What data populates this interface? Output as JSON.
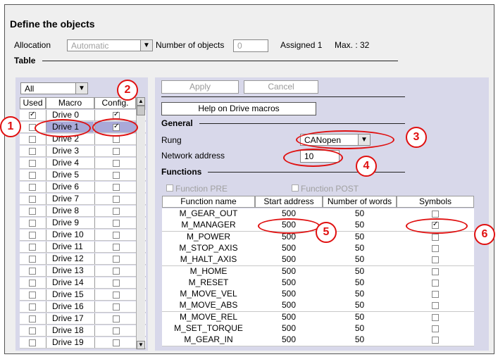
{
  "title": "Define the objects",
  "allocation": {
    "label": "Allocation",
    "value": "Automatic"
  },
  "num_objects": {
    "label": "Number of objects",
    "value": "0"
  },
  "assigned": "Assigned 1",
  "max": "Max. : 32",
  "table_label": "Table",
  "filter": {
    "value": "All"
  },
  "left_headers": {
    "used": "Used",
    "macro": "Macro",
    "config": "Config."
  },
  "macros": [
    {
      "name": "Drive 0",
      "used": true,
      "config": true
    },
    {
      "name": "Drive 1",
      "used": false,
      "config": true
    },
    {
      "name": "Drive 2",
      "used": false,
      "config": false
    },
    {
      "name": "Drive 3",
      "used": false,
      "config": false
    },
    {
      "name": "Drive 4",
      "used": false,
      "config": false
    },
    {
      "name": "Drive 5",
      "used": false,
      "config": false
    },
    {
      "name": "Drive 6",
      "used": false,
      "config": false
    },
    {
      "name": "Drive 7",
      "used": false,
      "config": false
    },
    {
      "name": "Drive 8",
      "used": false,
      "config": false
    },
    {
      "name": "Drive 9",
      "used": false,
      "config": false
    },
    {
      "name": "Drive 10",
      "used": false,
      "config": false
    },
    {
      "name": "Drive 11",
      "used": false,
      "config": false
    },
    {
      "name": "Drive 12",
      "used": false,
      "config": false
    },
    {
      "name": "Drive 13",
      "used": false,
      "config": false
    },
    {
      "name": "Drive 14",
      "used": false,
      "config": false
    },
    {
      "name": "Drive 15",
      "used": false,
      "config": false
    },
    {
      "name": "Drive 16",
      "used": false,
      "config": false
    },
    {
      "name": "Drive 17",
      "used": false,
      "config": false
    },
    {
      "name": "Drive 18",
      "used": false,
      "config": false
    },
    {
      "name": "Drive 19",
      "used": false,
      "config": false
    }
  ],
  "buttons": {
    "apply": "Apply",
    "cancel": "Cancel",
    "help": "Help on Drive macros"
  },
  "general": {
    "heading": "General",
    "rung_label": "Rung",
    "rung_value": "CANopen",
    "network_label": "Network address",
    "network_value": "10"
  },
  "functions": {
    "heading": "Functions",
    "pre": "Function PRE",
    "post": "Function POST",
    "headers": {
      "name": "Function name",
      "start": "Start address",
      "words": "Number of words",
      "symbols": "Symbols"
    },
    "rows": [
      {
        "name": "M_GEAR_OUT",
        "start": "500",
        "words": "50",
        "symbol": false
      },
      {
        "name": "M_MANAGER",
        "start": "500",
        "words": "50",
        "symbol": true
      },
      {
        "name": "M_POWER",
        "start": "500",
        "words": "50",
        "symbol": false
      },
      {
        "name": "M_STOP_AXIS",
        "start": "500",
        "words": "50",
        "symbol": false
      },
      {
        "name": "M_HALT_AXIS",
        "start": "500",
        "words": "50",
        "symbol": false
      },
      {
        "name": "M_HOME",
        "start": "500",
        "words": "50",
        "symbol": false
      },
      {
        "name": "M_RESET",
        "start": "500",
        "words": "50",
        "symbol": false
      },
      {
        "name": "M_MOVE_VEL",
        "start": "500",
        "words": "50",
        "symbol": false
      },
      {
        "name": "M_MOVE_ABS",
        "start": "500",
        "words": "50",
        "symbol": false
      },
      {
        "name": "M_MOVE_REL",
        "start": "500",
        "words": "50",
        "symbol": false
      },
      {
        "name": "M_SET_TORQUE",
        "start": "500",
        "words": "50",
        "symbol": false
      },
      {
        "name": "M_GEAR_IN",
        "start": "500",
        "words": "50",
        "symbol": false
      }
    ]
  },
  "callouts": [
    "1",
    "2",
    "3",
    "4",
    "5",
    "6"
  ],
  "colors": {
    "callout": "#e01010",
    "panel": "#d8d8ea",
    "highlight": "#a9a9d8"
  }
}
